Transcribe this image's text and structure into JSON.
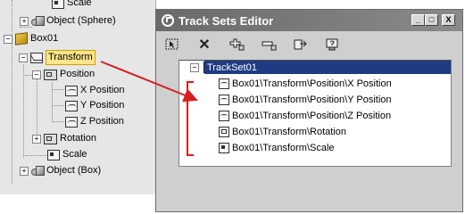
{
  "tree": {
    "items": [
      {
        "label": "Scale",
        "icon": "scale-icon"
      },
      {
        "label": "Object (Sphere)",
        "icon": "object-icon"
      },
      {
        "label": "Box01",
        "icon": "box-icon"
      },
      {
        "label": "Transform",
        "icon": "transform-icon",
        "highlighted": true
      },
      {
        "label": "Position",
        "icon": "position-icon"
      },
      {
        "label": "X Position",
        "icon": "curve-icon"
      },
      {
        "label": "Y Position",
        "icon": "curve-icon"
      },
      {
        "label": "Z Position",
        "icon": "curve-icon"
      },
      {
        "label": "Rotation",
        "icon": "rotation-icon"
      },
      {
        "label": "Scale",
        "icon": "scale-icon"
      },
      {
        "label": "Object (Box)",
        "icon": "object-icon"
      }
    ]
  },
  "editor": {
    "title": "Track Sets Editor",
    "window_buttons": {
      "minimize": "_",
      "maximize": "□",
      "close": "X"
    },
    "toolbar": {
      "items": [
        "select-icon",
        "delete-icon",
        "add-track-icon",
        "remove-track-icon",
        "assign-icon",
        "help-icon"
      ],
      "delete_glyph": "✕"
    },
    "trackset": {
      "expander": "−",
      "name": "TrackSet01",
      "tracks": [
        {
          "label": "Box01\\Transform\\Position\\X Position",
          "icon": "curve-icon"
        },
        {
          "label": "Box01\\Transform\\Position\\Y Position",
          "icon": "curve-icon"
        },
        {
          "label": "Box01\\Transform\\Position\\Z Position",
          "icon": "curve-icon"
        },
        {
          "label": "Box01\\Transform\\Rotation",
          "icon": "rotation-icon"
        },
        {
          "label": "Box01\\Transform\\Scale",
          "icon": "scale-icon"
        }
      ]
    }
  },
  "colors": {
    "title_bar": "#6a6a6a",
    "selection": "#1f3b83",
    "highlight": "#ffe58a",
    "annotation": "#d62020"
  },
  "expanders": {
    "collapse": "−",
    "expand": "+"
  }
}
